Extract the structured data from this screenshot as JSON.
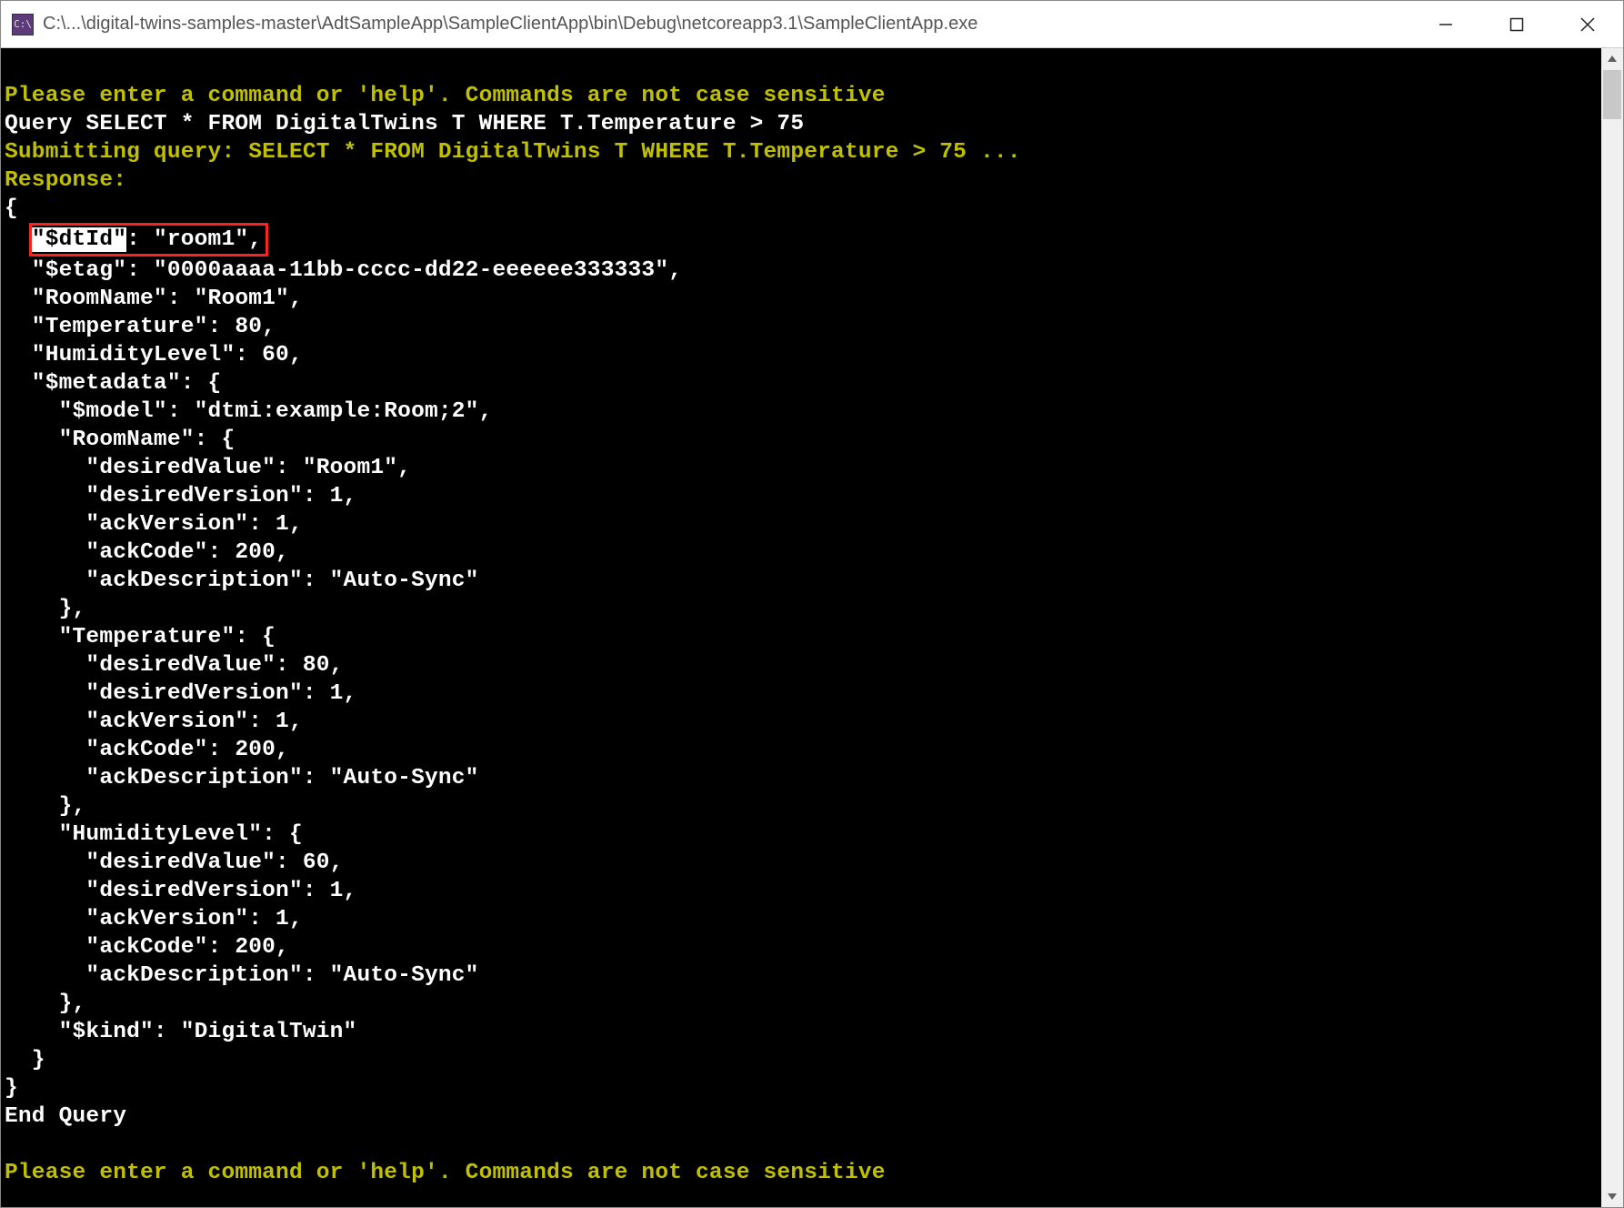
{
  "window": {
    "icon_label": "C:\\",
    "title": "C:\\...\\digital-twins-samples-master\\AdtSampleApp\\SampleClientApp\\bin\\Debug\\netcoreapp3.1\\SampleClientApp.exe"
  },
  "console": {
    "prompt1": "Please enter a command or 'help'. Commands are not case sensitive",
    "query_line": "Query SELECT * FROM DigitalTwins T WHERE T.Temperature > 75",
    "submitting": "Submitting query: SELECT * FROM DigitalTwins T WHERE T.Temperature > 75 ...",
    "response_label": "Response:",
    "brace_open": "{",
    "dtid_key": "\"$dtId\"",
    "dtid_rest": ": \"room1\",",
    "etag": "  \"$etag\": \"0000aaaa-11bb-cccc-dd22-eeeeee333333\",",
    "room_name": "  \"RoomName\": \"Room1\",",
    "temperature": "  \"Temperature\": 80,",
    "humidity": "  \"HumidityLevel\": 60,",
    "metadata_open": "  \"$metadata\": {",
    "model": "    \"$model\": \"dtmi:example:Room;2\",",
    "rn_open": "    \"RoomName\": {",
    "rn_desired_value": "      \"desiredValue\": \"Room1\",",
    "rn_desired_version": "      \"desiredVersion\": 1,",
    "rn_ack_version": "      \"ackVersion\": 1,",
    "rn_ack_code": "      \"ackCode\": 200,",
    "rn_ack_desc": "      \"ackDescription\": \"Auto-Sync\"",
    "rn_close": "    },",
    "t_open": "    \"Temperature\": {",
    "t_desired_value": "      \"desiredValue\": 80,",
    "t_desired_version": "      \"desiredVersion\": 1,",
    "t_ack_version": "      \"ackVersion\": 1,",
    "t_ack_code": "      \"ackCode\": 200,",
    "t_ack_desc": "      \"ackDescription\": \"Auto-Sync\"",
    "t_close": "    },",
    "h_open": "    \"HumidityLevel\": {",
    "h_desired_value": "      \"desiredValue\": 60,",
    "h_desired_version": "      \"desiredVersion\": 1,",
    "h_ack_version": "      \"ackVersion\": 1,",
    "h_ack_code": "      \"ackCode\": 200,",
    "h_ack_desc": "      \"ackDescription\": \"Auto-Sync\"",
    "h_close": "    },",
    "kind": "    \"$kind\": \"DigitalTwin\"",
    "metadata_close": "  }",
    "brace_close": "}",
    "end_query": "End Query",
    "blank": "",
    "prompt2": "Please enter a command or 'help'. Commands are not case sensitive"
  }
}
